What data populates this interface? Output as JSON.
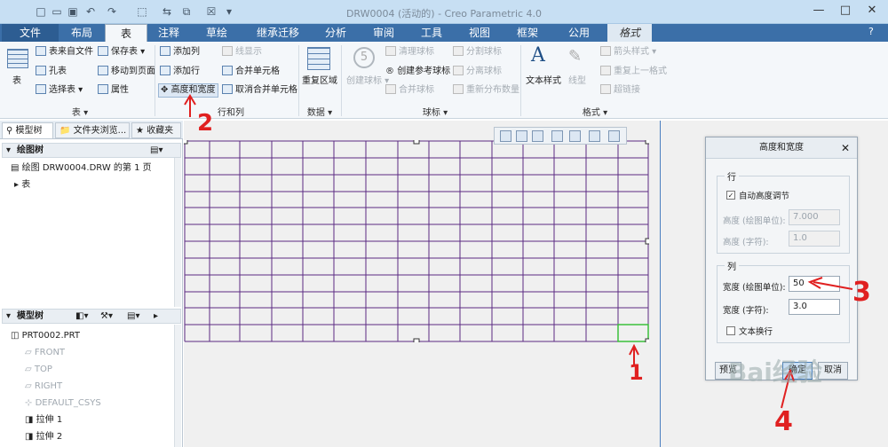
{
  "window": {
    "title": "DRW0004 (活动的) - Creo Parametric 4.0"
  },
  "tabs": [
    "文件",
    "布局",
    "表",
    "注释",
    "草绘",
    "继承迁移",
    "分析",
    "审阅",
    "工具",
    "视图",
    "框架",
    "公用",
    "格式"
  ],
  "ribbon": {
    "table": {
      "big": "表",
      "table_from_file": "表来自文件",
      "save_table": "保存表",
      "hole_table": "孔表",
      "move_to_page": "移动到页面",
      "select_table": "选择表",
      "properties": "属性",
      "group": "表"
    },
    "rows_cols": {
      "add_column": "添加列",
      "add_row": "添加行",
      "height_width": "高度和宽度",
      "line_display": "线显示",
      "merge_cells": "合并单元格",
      "unmerge_cells": "取消合并单元格",
      "group": "行和列"
    },
    "data": {
      "repeat_region": "重复区域",
      "group": "数据"
    },
    "balloons": {
      "create_balloons": "创建球标",
      "clean_balloons": "清理球标",
      "create_ref_balloon": "创建参考球标",
      "merge_balloons": "合并球标",
      "split_balloons": "分割球标",
      "separate_balloons": "分离球标",
      "redistribute_qty": "重新分布数量",
      "group": "球标"
    },
    "format": {
      "text_style": "文本样式",
      "line_style": "线型",
      "arrow_style": "箭头样式",
      "repeat_last_format": "重复上一格式",
      "hyperlink": "超链接",
      "group": "格式"
    }
  },
  "panel": {
    "tabs": [
      "模型树",
      "文件夹浏览...",
      "收藏夹"
    ],
    "drawing_tree_title": "绘图树",
    "drawing_tree_items": [
      "绘图 DRW0004.DRW 的第 1 页",
      "表"
    ],
    "model_tree_title": "模型树",
    "model_tree_items": [
      "PRT0002.PRT",
      "FRONT",
      "TOP",
      "RIGHT",
      "DEFAULT_CSYS",
      "拉伸 1",
      "拉伸 2"
    ]
  },
  "dialog": {
    "title": "高度和宽度",
    "rows": {
      "legend": "行",
      "auto_height": "自动高度调节",
      "height_units_label": "高度 (绘图单位):",
      "height_units_value": "7.000",
      "height_chars_label": "高度 (字符):",
      "height_chars_value": "1.0"
    },
    "cols": {
      "legend": "列",
      "width_units_label": "宽度 (绘图单位):",
      "width_units_value": "50",
      "width_chars_label": "宽度 (字符):",
      "width_chars_value": "3.0",
      "wrap_text": "文本换行"
    },
    "buttons": {
      "preview": "预览",
      "ok": "确定",
      "cancel": "取消"
    }
  },
  "annotations": [
    "1",
    "2",
    "3",
    "4"
  ],
  "colors": {
    "accent": "#3b6fa8",
    "grid": "#5b2a82",
    "annotation": "#e02020",
    "selected_cell": "#3bbf3b"
  }
}
